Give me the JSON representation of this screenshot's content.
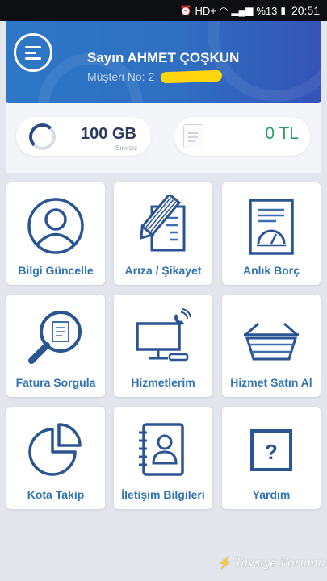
{
  "status_bar": {
    "alarm_icon": "alarm-clock-icon",
    "network": "HD+",
    "battery": "%13",
    "time": "20:51"
  },
  "header": {
    "greeting": "Sayın AHMET ÇOŞKUN",
    "customer_label": "Müşteri No:",
    "customer_number": "2",
    "colors": {
      "gradient_start": "#2e77c6",
      "gradient_end": "#3553b6",
      "redaction": "#ffd60d"
    }
  },
  "summary": {
    "data": {
      "value": "100 GB",
      "sub": "Sınırsız"
    },
    "bill": {
      "value": "0 TL",
      "color": "#2d9c66"
    }
  },
  "tiles": [
    {
      "label": "Bilgi Güncelle",
      "icon": "user-profile-icon"
    },
    {
      "label": "Arıza / Şikayet",
      "icon": "document-pencil-icon"
    },
    {
      "label": "Anlık Borç",
      "icon": "bill-gauge-icon"
    },
    {
      "label": "Fatura Sorgula",
      "icon": "magnifier-invoice-icon"
    },
    {
      "label": "Hizmetlerim",
      "icon": "computer-phone-icon"
    },
    {
      "label": "Hizmet Satın Al",
      "icon": "shopping-basket-icon"
    },
    {
      "label": "Kota Takip",
      "icon": "pie-chart-icon"
    },
    {
      "label": "İletişim Bilgileri",
      "icon": "address-book-icon"
    },
    {
      "label": "Yardım",
      "icon": "question-box-icon"
    }
  ],
  "accent_color": "#2f74b1",
  "watermark": "Tavsiye Forumu"
}
